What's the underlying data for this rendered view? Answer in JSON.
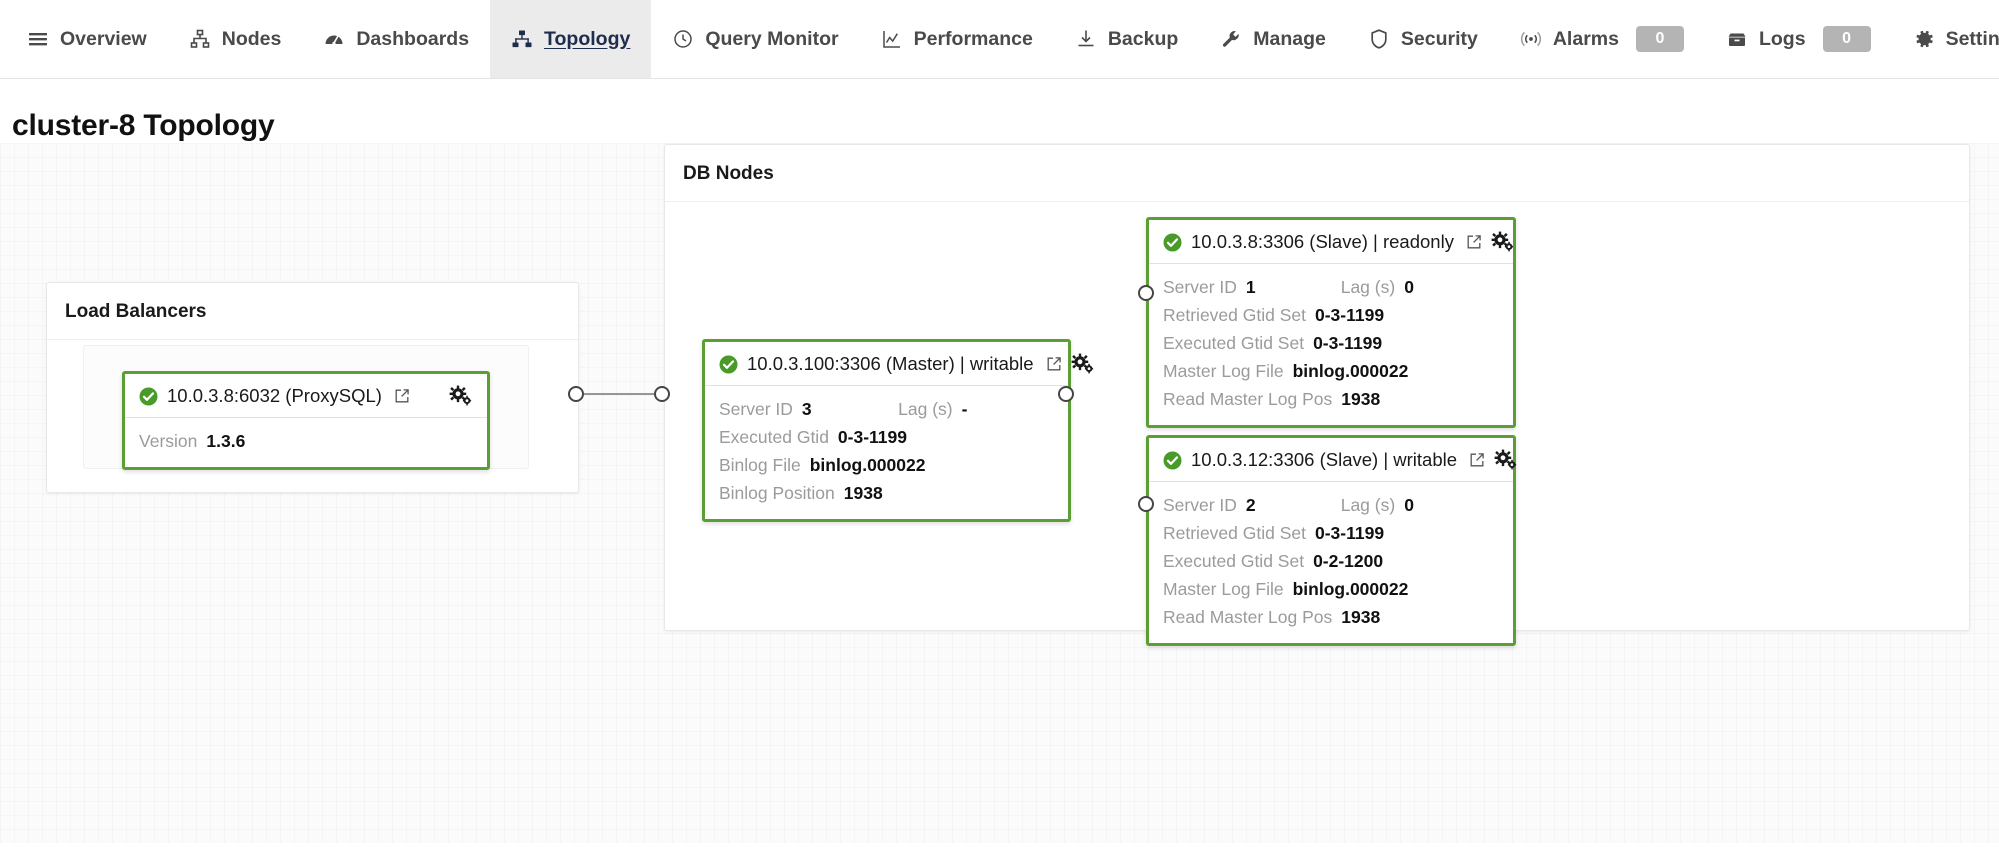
{
  "nav": {
    "items": [
      {
        "label": "Overview",
        "icon": "menu-icon",
        "active": false
      },
      {
        "label": "Nodes",
        "icon": "sitemap-icon",
        "active": false
      },
      {
        "label": "Dashboards",
        "icon": "gauge-icon",
        "active": false
      },
      {
        "label": "Topology",
        "icon": "topology-icon",
        "active": true
      },
      {
        "label": "Query Monitor",
        "icon": "clock-icon",
        "active": false
      },
      {
        "label": "Performance",
        "icon": "chart-line-icon",
        "active": false
      },
      {
        "label": "Backup",
        "icon": "download-icon",
        "active": false
      },
      {
        "label": "Manage",
        "icon": "wrench-icon",
        "active": false
      },
      {
        "label": "Security",
        "icon": "shield-icon",
        "active": false
      },
      {
        "label": "Alarms",
        "icon": "broadcast-icon",
        "active": false,
        "badge": "0"
      },
      {
        "label": "Logs",
        "icon": "archive-icon",
        "active": false,
        "badge": "0"
      },
      {
        "label": "Settings",
        "icon": "gear-icon",
        "active": false
      }
    ]
  },
  "page": {
    "title": "cluster-8 Topology"
  },
  "groups": {
    "load_balancers": {
      "title": "Load Balancers"
    },
    "db_nodes": {
      "title": "DB Nodes"
    }
  },
  "colors": {
    "node_border_green": "#5a9e34",
    "status_ok_green": "#4a9a2a",
    "active_tab_bg": "#ebebeb",
    "active_tab_text": "#1f2d4d",
    "collapse_tab_bg": "#3a444c",
    "badge_bg": "#b4b4b4",
    "canvas_bg": "#fbfbfb"
  },
  "nodes": {
    "proxysql": {
      "name": "10.0.3.8:6032 (ProxySQL)",
      "status": "ok",
      "props": [
        {
          "key": "Version",
          "value": "1.3.6"
        }
      ]
    },
    "master": {
      "name": "10.0.3.100:3306 (Master) | writable",
      "status": "ok",
      "props": [
        {
          "key": "Server ID",
          "value": "3",
          "key2": "Lag (s)",
          "value2": "-"
        },
        {
          "key": "Executed Gtid",
          "value": "0-3-1199"
        },
        {
          "key": "Binlog File",
          "value": "binlog.000022"
        },
        {
          "key": "Binlog Position",
          "value": "1938"
        }
      ]
    },
    "slave1": {
      "name": "10.0.3.8:3306 (Slave) | readonly",
      "status": "ok",
      "props": [
        {
          "key": "Server ID",
          "value": "1",
          "key2": "Lag (s)",
          "value2": "0"
        },
        {
          "key": "Retrieved Gtid Set",
          "value": "0-3-1199"
        },
        {
          "key": "Executed Gtid Set",
          "value": "0-3-1199"
        },
        {
          "key": "Master Log File",
          "value": "binlog.000022"
        },
        {
          "key": "Read Master Log Pos",
          "value": "1938"
        }
      ]
    },
    "slave2": {
      "name": "10.0.3.12:3306 (Slave) | writable",
      "status": "ok",
      "props": [
        {
          "key": "Server ID",
          "value": "2",
          "key2": "Lag (s)",
          "value2": "0"
        },
        {
          "key": "Retrieved Gtid Set",
          "value": "0-3-1199"
        },
        {
          "key": "Executed Gtid Set",
          "value": "0-2-1200"
        },
        {
          "key": "Master Log File",
          "value": "binlog.000022"
        },
        {
          "key": "Read Master Log Pos",
          "value": "1938"
        }
      ]
    }
  }
}
